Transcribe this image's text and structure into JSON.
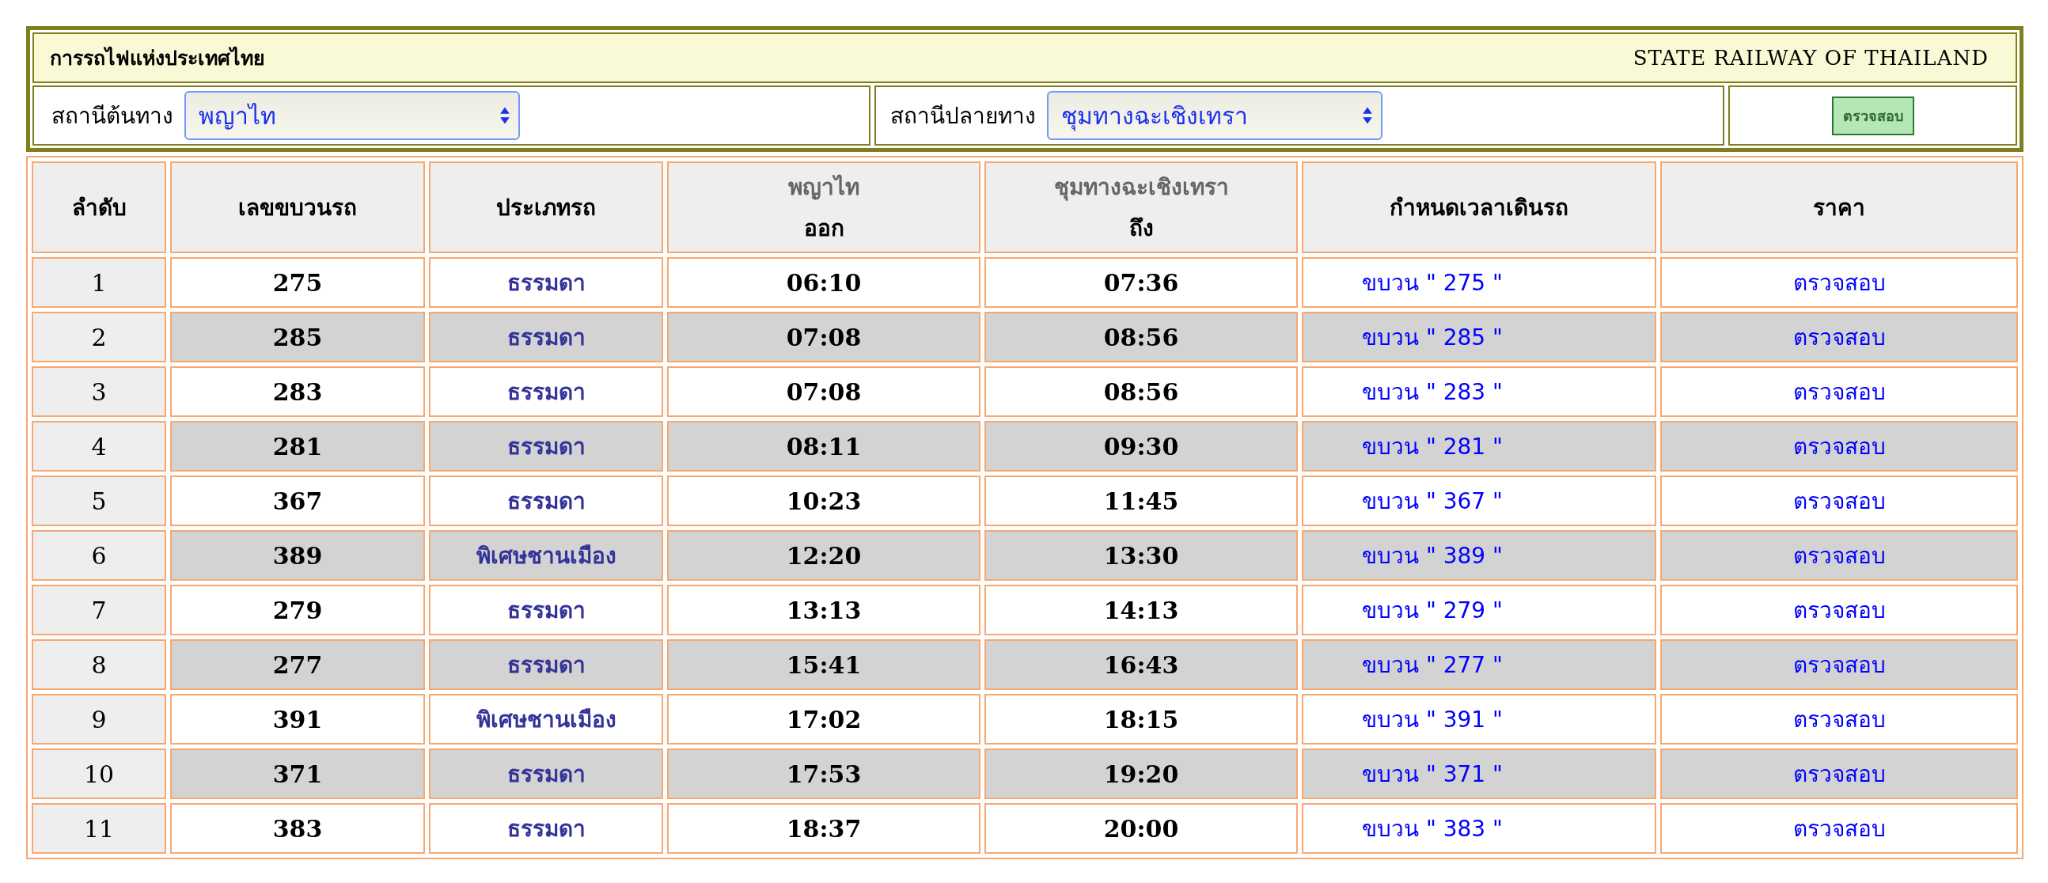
{
  "header": {
    "title_th": "การรถไฟแห่งประเทศไทย",
    "title_en": "STATE RAILWAY OF THAILAND"
  },
  "search": {
    "origin": {
      "label": "สถานีต้นทาง",
      "value": "พญาไท"
    },
    "destination": {
      "label": "สถานีปลายทาง",
      "value": "ชุมทางฉะเชิงเทรา"
    },
    "button": "ตรวจสอบ"
  },
  "table": {
    "columns": [
      {
        "label": "ลำดับ"
      },
      {
        "label": "เลขขบวนรถ"
      },
      {
        "label": "ประเภทรถ"
      },
      {
        "station": "พญาไท",
        "label": "ออก"
      },
      {
        "station": "ชุมทางฉะเชิงเทรา",
        "label": "ถึง"
      },
      {
        "label": "กำหนดเวลาเดินรถ"
      },
      {
        "label": "ราคา"
      }
    ],
    "rows": [
      {
        "no": "1",
        "train": "275",
        "type": "ธรรมดา",
        "depart": "06:10",
        "arrive": "07:36",
        "schedule": "ขบวน \" 275 \"",
        "price": "ตรวจสอบ"
      },
      {
        "no": "2",
        "train": "285",
        "type": "ธรรมดา",
        "depart": "07:08",
        "arrive": "08:56",
        "schedule": "ขบวน \" 285 \"",
        "price": "ตรวจสอบ"
      },
      {
        "no": "3",
        "train": "283",
        "type": "ธรรมดา",
        "depart": "07:08",
        "arrive": "08:56",
        "schedule": "ขบวน \" 283 \"",
        "price": "ตรวจสอบ"
      },
      {
        "no": "4",
        "train": "281",
        "type": "ธรรมดา",
        "depart": "08:11",
        "arrive": "09:30",
        "schedule": "ขบวน \" 281 \"",
        "price": "ตรวจสอบ"
      },
      {
        "no": "5",
        "train": "367",
        "type": "ธรรมดา",
        "depart": "10:23",
        "arrive": "11:45",
        "schedule": "ขบวน \" 367 \"",
        "price": "ตรวจสอบ"
      },
      {
        "no": "6",
        "train": "389",
        "type": "พิเศษชานเมือง",
        "depart": "12:20",
        "arrive": "13:30",
        "schedule": "ขบวน \" 389 \"",
        "price": "ตรวจสอบ"
      },
      {
        "no": "7",
        "train": "279",
        "type": "ธรรมดา",
        "depart": "13:13",
        "arrive": "14:13",
        "schedule": "ขบวน \" 279 \"",
        "price": "ตรวจสอบ"
      },
      {
        "no": "8",
        "train": "277",
        "type": "ธรรมดา",
        "depart": "15:41",
        "arrive": "16:43",
        "schedule": "ขบวน \" 277 \"",
        "price": "ตรวจสอบ"
      },
      {
        "no": "9",
        "train": "391",
        "type": "พิเศษชานเมือง",
        "depart": "17:02",
        "arrive": "18:15",
        "schedule": "ขบวน \" 391 \"",
        "price": "ตรวจสอบ"
      },
      {
        "no": "10",
        "train": "371",
        "type": "ธรรมดา",
        "depart": "17:53",
        "arrive": "19:20",
        "schedule": "ขบวน \" 371 \"",
        "price": "ตรวจสอบ"
      },
      {
        "no": "11",
        "train": "383",
        "type": "ธรรมดา",
        "depart": "18:37",
        "arrive": "20:00",
        "schedule": "ขบวน \" 383 \"",
        "price": "ตรวจสอบ"
      }
    ]
  }
}
